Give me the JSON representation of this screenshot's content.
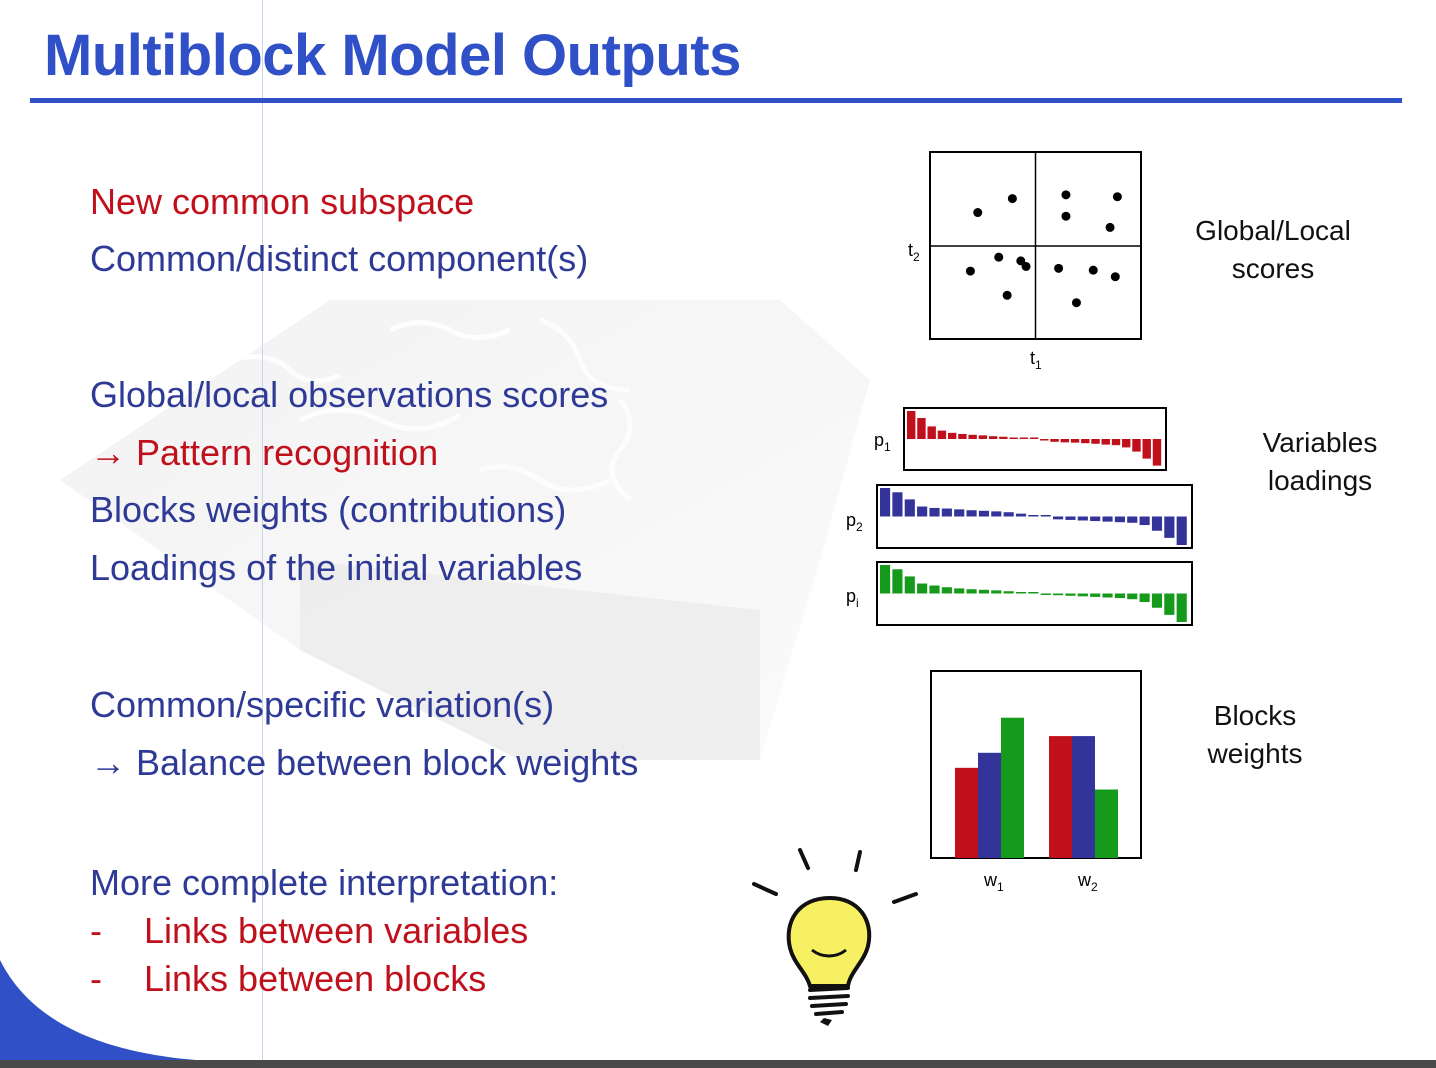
{
  "slide": {
    "title": "Multiblock Model Outputs",
    "lines": [
      {
        "text": "New common subspace",
        "color": "red"
      },
      {
        "text": "Common/distinct component(s)",
        "color": "blue"
      },
      {
        "text": "Global/local observations scores",
        "color": "blue"
      },
      {
        "text": "Pattern recognition",
        "color": "red",
        "arrow": "→"
      },
      {
        "text": "Blocks weights (contributions)",
        "color": "blue"
      },
      {
        "text": "Loadings of the initial variables",
        "color": "blue"
      },
      {
        "text": "Common/specific variation(s)",
        "color": "blue"
      },
      {
        "text": "Balance between block weights",
        "color": "blue",
        "arrow": "→"
      },
      {
        "text": "More complete interpretation:",
        "color": "blue"
      },
      {
        "text": "Links between variables",
        "color": "red",
        "bullet": "-"
      },
      {
        "text": "Links between blocks",
        "color": "red",
        "bullet": "-"
      }
    ],
    "arrow_glyph": "→",
    "dash_glyph": "-",
    "colors": {
      "title": "#3050c8",
      "red": "#c0101c",
      "blue": "#2e3a96",
      "series_red": "#c0101c",
      "series_blue": "#333399",
      "series_green": "#169a1c"
    }
  },
  "scores_plot": {
    "label_line1": "Global/Local",
    "label_line2": "scores",
    "x_axis": "t",
    "x_sub": "1",
    "y_axis": "t",
    "y_sub": "2",
    "points": [
      [
        -0.55,
        0.36
      ],
      [
        -0.22,
        0.51
      ],
      [
        -0.14,
        -0.16
      ],
      [
        0.29,
        0.55
      ],
      [
        0.29,
        0.32
      ],
      [
        0.78,
        0.53
      ],
      [
        0.71,
        0.2
      ],
      [
        -0.62,
        -0.27
      ],
      [
        -0.35,
        -0.12
      ],
      [
        -0.09,
        -0.22
      ],
      [
        0.22,
        -0.24
      ],
      [
        0.55,
        -0.26
      ],
      [
        0.76,
        -0.33
      ],
      [
        -0.27,
        -0.53
      ],
      [
        0.39,
        -0.61
      ]
    ]
  },
  "loadings": {
    "label_line1": "Variables",
    "label_line2": "loadings",
    "blocks": [
      {
        "name": "p",
        "sub": "1",
        "color": "#c0101c",
        "values": [
          1.0,
          0.75,
          0.45,
          0.3,
          0.22,
          0.18,
          0.15,
          0.13,
          0.1,
          0.08,
          0.05,
          0.03,
          0.0,
          -0.05,
          -0.1,
          -0.12,
          -0.13,
          -0.15,
          -0.17,
          -0.2,
          -0.22,
          -0.3,
          -0.45,
          -0.7,
          -0.95
        ]
      },
      {
        "name": "p",
        "sub": "2",
        "color": "#333399",
        "values": [
          1.0,
          0.85,
          0.6,
          0.35,
          0.3,
          0.28,
          0.25,
          0.22,
          0.2,
          0.18,
          0.15,
          0.1,
          0.05,
          0.0,
          -0.1,
          -0.12,
          -0.14,
          -0.16,
          -0.18,
          -0.2,
          -0.22,
          -0.3,
          -0.5,
          -0.75,
          -1.0
        ]
      },
      {
        "name": "p",
        "sub": "i",
        "color": "#169a1c",
        "values": [
          1.0,
          0.85,
          0.6,
          0.35,
          0.28,
          0.22,
          0.18,
          0.15,
          0.13,
          0.11,
          0.08,
          0.05,
          0.02,
          -0.02,
          -0.06,
          -0.08,
          -0.1,
          -0.12,
          -0.14,
          -0.16,
          -0.2,
          -0.3,
          -0.5,
          -0.75,
          -1.0
        ]
      }
    ]
  },
  "chart_data": {
    "type": "bar",
    "categories": [
      "w1",
      "w2"
    ],
    "series": [
      {
        "values": [
          0.54,
          0.73
        ],
        "color": "#c0101c"
      },
      {
        "values": [
          0.63,
          0.73
        ],
        "color": "#333399"
      },
      {
        "values": [
          0.84,
          0.41
        ],
        "color": "#169a1c"
      }
    ],
    "ylim": [
      0,
      1
    ],
    "legend_label_line1": "Blocks",
    "legend_label_line2": "weights",
    "tick_main": "w",
    "tick_subs": [
      "1",
      "2"
    ]
  },
  "bulb": {
    "icon": "lightbulb-icon",
    "fill": "#f7f062",
    "stroke": "#111111"
  }
}
